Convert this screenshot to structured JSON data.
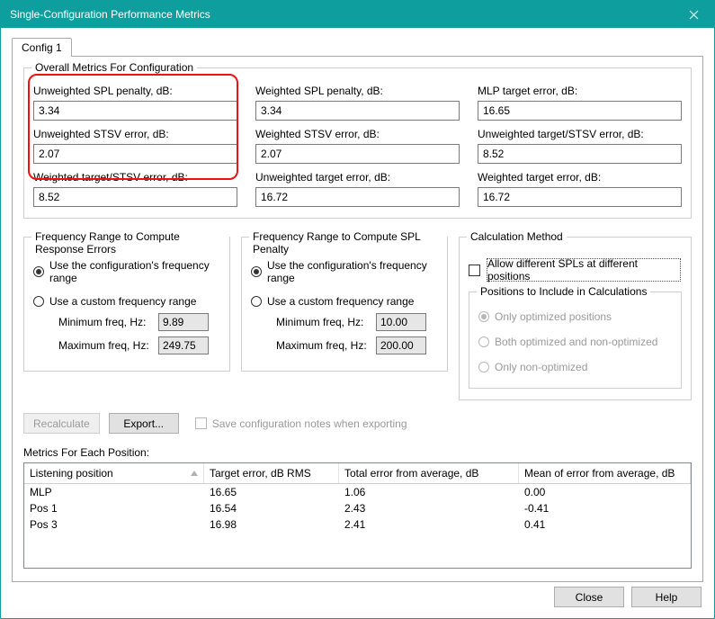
{
  "window": {
    "title": "Single-Configuration Performance Metrics"
  },
  "tabs": [
    "Config 1"
  ],
  "overall_group_title": "Overall Metrics For Configuration",
  "metrics": {
    "unw_spl_penalty": {
      "label": "Unweighted SPL penalty, dB:",
      "value": "3.34"
    },
    "w_spl_penalty": {
      "label": "Weighted SPL penalty, dB:",
      "value": "3.34"
    },
    "mlp_target": {
      "label": "MLP target error, dB:",
      "value": "16.65"
    },
    "unw_stsv": {
      "label": "Unweighted STSV error, dB:",
      "value": "2.07"
    },
    "w_stsv": {
      "label": "Weighted STSV error, dB:",
      "value": "2.07"
    },
    "unw_tgt_stsv": {
      "label": "Unweighted target/STSV error, dB:",
      "value": "8.52"
    },
    "w_tgt_stsv": {
      "label": "Weighted target/STSV error, dB:",
      "value": "8.52"
    },
    "unw_target": {
      "label": "Unweighted target error, dB:",
      "value": "16.72"
    },
    "w_target": {
      "label": "Weighted target error, dB:",
      "value": "16.72"
    }
  },
  "freq_response": {
    "title": "Frequency Range to Compute Response Errors",
    "opt_config": "Use the configuration's frequency range",
    "opt_custom": "Use a custom frequency range",
    "min_label": "Minimum freq, Hz:",
    "max_label": "Maximum freq, Hz:",
    "min": "9.89",
    "max": "249.75",
    "selected": "config"
  },
  "freq_spl": {
    "title": "Frequency Range to Compute SPL Penalty",
    "opt_config": "Use the configuration's frequency range",
    "opt_custom": "Use a custom frequency range",
    "min_label": "Minimum freq, Hz:",
    "max_label": "Maximum freq, Hz:",
    "min": "10.00",
    "max": "200.00",
    "selected": "config"
  },
  "calc_method": {
    "title": "Calculation Method",
    "allow_diff": "Allow different SPLs at different positions",
    "positions_title": "Positions to Include in Calculations",
    "opt_optimized": "Only optimized positions",
    "opt_both": "Both optimized and non-optimized",
    "opt_nonopt": "Only non-optimized"
  },
  "buttons": {
    "recalculate": "Recalculate",
    "export": "Export...",
    "save_notes": "Save configuration notes when exporting",
    "close": "Close",
    "help": "Help"
  },
  "list_label": "Metrics For Each Position:",
  "list_columns": [
    "Listening position",
    "Target error, dB RMS",
    "Total error from average, dB",
    "Mean of error from average, dB"
  ],
  "list_rows": [
    {
      "pos": "MLP",
      "target": "16.65",
      "total": "1.06",
      "mean": "0.00"
    },
    {
      "pos": "Pos 1",
      "target": "16.54",
      "total": "2.43",
      "mean": "-0.41"
    },
    {
      "pos": "Pos 3",
      "target": "16.98",
      "total": "2.41",
      "mean": "0.41"
    }
  ]
}
